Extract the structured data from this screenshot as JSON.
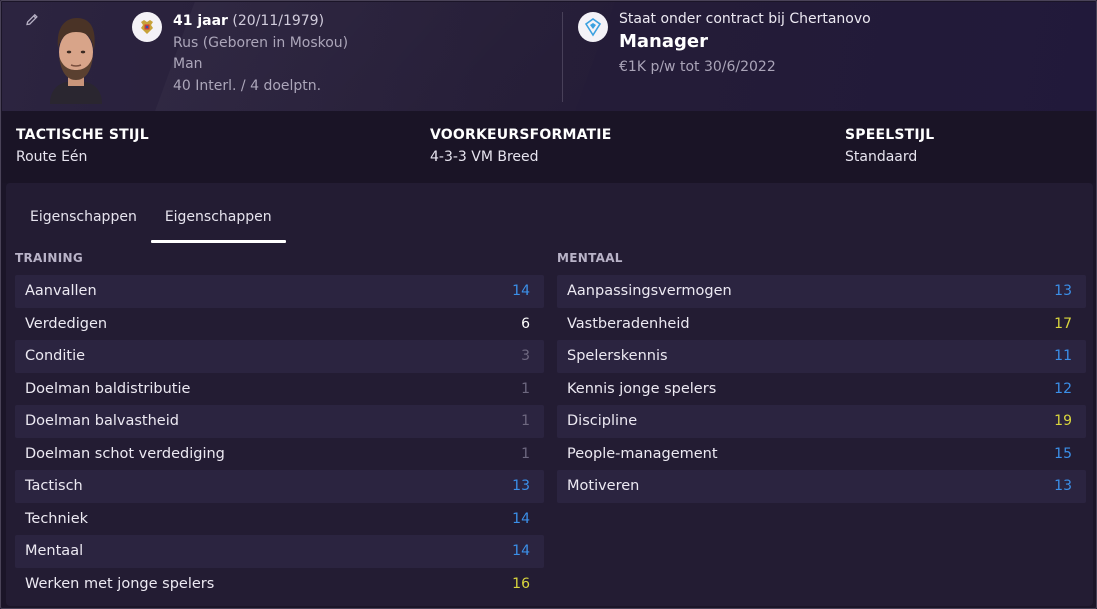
{
  "header": {
    "age": "41 jaar",
    "birthdate": "(20/11/1979)",
    "nationality": "Rus (Geboren in Moskou)",
    "gender": "Man",
    "caps": "40 Interl. / 4 doelptn."
  },
  "contract": {
    "line1": "Staat onder contract bij Chertanovo",
    "role": "Manager",
    "wage": "€1K p/w tot 30/6/2022"
  },
  "style": {
    "tactical_label": "TACTISCHE STIJL",
    "tactical_value": "Route Eén",
    "formation_label": "VOORKEURSFORMATIE",
    "formation_value": "4-3-3 VM Breed",
    "playstyle_label": "SPEELSTIJL",
    "playstyle_value": "Standaard"
  },
  "tabs": [
    "Eigenschappen",
    "Eigenschappen"
  ],
  "training": {
    "title": "TRAINING",
    "rows": [
      {
        "name": "Aanvallen",
        "value": "14",
        "color": "blue"
      },
      {
        "name": "Verdedigen",
        "value": "6",
        "color": "white"
      },
      {
        "name": "Conditie",
        "value": "3",
        "color": "grey"
      },
      {
        "name": "Doelman baldistributie",
        "value": "1",
        "color": "grey"
      },
      {
        "name": "Doelman balvastheid",
        "value": "1",
        "color": "grey"
      },
      {
        "name": "Doelman schot verdediging",
        "value": "1",
        "color": "grey"
      },
      {
        "name": "Tactisch",
        "value": "13",
        "color": "blue"
      },
      {
        "name": "Techniek",
        "value": "14",
        "color": "blue"
      },
      {
        "name": "Mentaal",
        "value": "14",
        "color": "blue"
      },
      {
        "name": "Werken met jonge spelers",
        "value": "16",
        "color": "yellow"
      }
    ]
  },
  "mental": {
    "title": "MENTAAL",
    "rows": [
      {
        "name": "Aanpassingsvermogen",
        "value": "13",
        "color": "blue"
      },
      {
        "name": "Vastberadenheid",
        "value": "17",
        "color": "yellow"
      },
      {
        "name": "Spelerskennis",
        "value": "11",
        "color": "blue"
      },
      {
        "name": "Kennis jonge spelers",
        "value": "12",
        "color": "blue"
      },
      {
        "name": "Discipline",
        "value": "19",
        "color": "yellow"
      },
      {
        "name": "People-management",
        "value": "15",
        "color": "blue"
      },
      {
        "name": "Motiveren",
        "value": "13",
        "color": "blue"
      }
    ]
  },
  "colors": {
    "blue": "#3b8fe8",
    "white": "#ffffff",
    "grey": "#6e6880",
    "yellow": "#d9d63d"
  },
  "icons": {
    "edit": "pencil-icon",
    "nation": "russia-crest-icon",
    "club": "chertanovo-crest-icon"
  }
}
